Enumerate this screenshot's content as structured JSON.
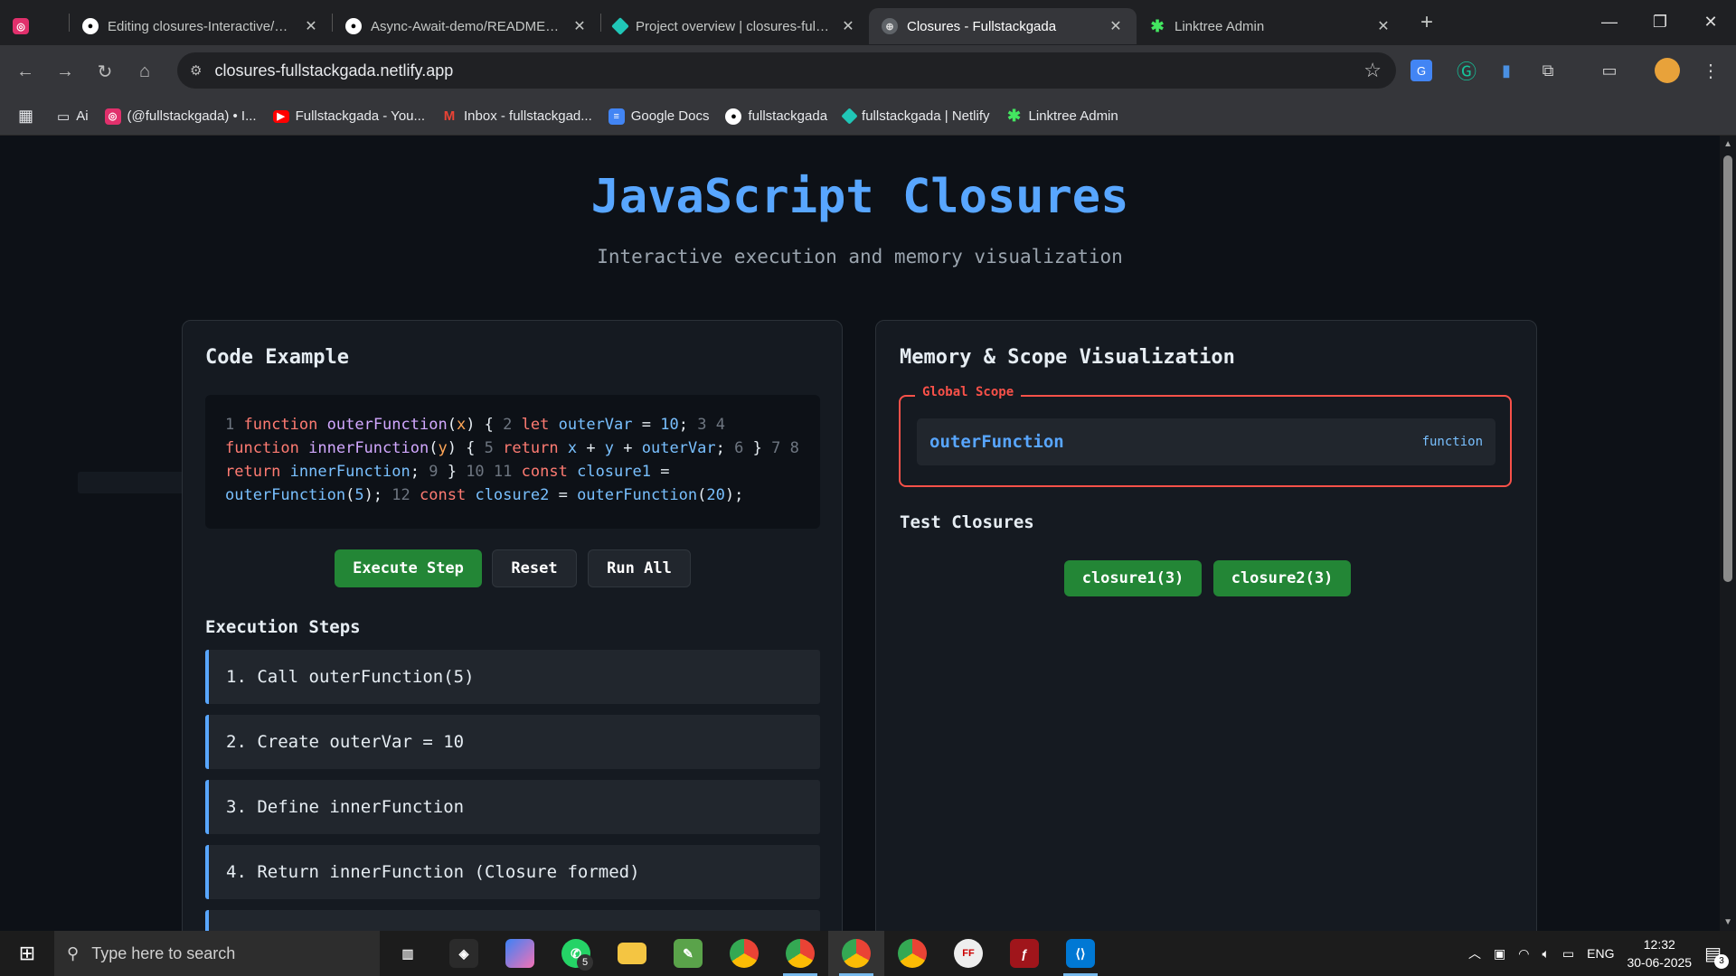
{
  "tabs": [
    {
      "title": "",
      "icon": "instagram-icon",
      "color": "#e1306c"
    },
    {
      "title": "Editing closures-Interactive/README",
      "icon": "github-icon",
      "color": "#ffffff"
    },
    {
      "title": "Async-Await-demo/README.md",
      "icon": "github-icon",
      "color": "#ffffff"
    },
    {
      "title": "Project overview | closures-fullstackgada",
      "icon": "netlify-icon",
      "color": "#20c6b7"
    },
    {
      "title": "Closures - Fullstackgada",
      "icon": "globe-icon",
      "color": "#9aa0a6"
    },
    {
      "title": "Linktree Admin",
      "icon": "linktree-icon",
      "color": "#43e660"
    }
  ],
  "address": {
    "url": "closures-fullstackgada.netlify.app"
  },
  "bookmarks": [
    {
      "label": "Ai",
      "icon": "folder-icon"
    },
    {
      "label": "(@fullstackgada) • I...",
      "icon": "instagram-icon"
    },
    {
      "label": "Fullstackgada - You...",
      "icon": "youtube-icon"
    },
    {
      "label": "Inbox - fullstackgad...",
      "icon": "gmail-icon"
    },
    {
      "label": "Google Docs",
      "icon": "docs-icon"
    },
    {
      "label": "fullstackgada",
      "icon": "github-icon"
    },
    {
      "label": "fullstackgada | Netlify",
      "icon": "netlify-icon"
    },
    {
      "label": "Linktree Admin",
      "icon": "linktree-icon"
    }
  ],
  "page": {
    "title": "JavaScript Closures",
    "subtitle": "Interactive execution and memory visualization"
  },
  "code_panel": {
    "heading": "Code Example",
    "buttons": {
      "execute": "Execute Step",
      "reset": "Reset",
      "run_all": "Run All"
    },
    "steps_heading": "Execution Steps",
    "steps": [
      "1. Call outerFunction(5)",
      "2. Create outerVar = 10",
      "3. Define innerFunction",
      "4. Return innerFunction (Closure formed)"
    ]
  },
  "memory_panel": {
    "heading": "Memory & Scope Visualization",
    "scope_label": "Global Scope",
    "variable": {
      "name": "outerFunction",
      "type": "function"
    },
    "test_heading": "Test Closures",
    "test_buttons": [
      "closure1(3)",
      "closure2(3)"
    ]
  },
  "taskbar": {
    "search_placeholder": "Type here to search",
    "whatsapp_badge": "5",
    "language": "ENG",
    "time": "12:32",
    "date": "30-06-2025",
    "notifications": "3"
  },
  "colors": {
    "accent": "#58a6ff",
    "green": "#238636",
    "scope": "#f85149"
  }
}
